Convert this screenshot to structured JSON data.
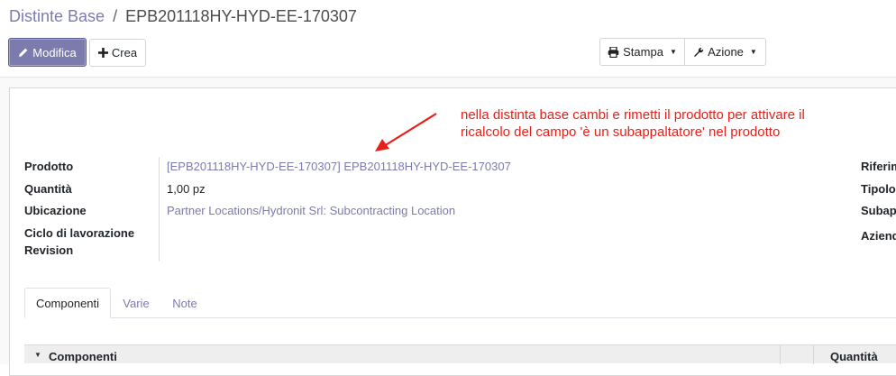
{
  "breadcrumb": {
    "parent": "Distinte Base",
    "separator": "/",
    "current": "EPB201118HY-HYD-EE-170307"
  },
  "toolbar": {
    "edit_label": "Modifica",
    "create_label": "Crea",
    "print_label": "Stampa",
    "action_label": "Azione"
  },
  "annotation": {
    "line1": "nella distinta base cambi e rimetti il prodotto per attivare il",
    "line2": "ricalcolo del campo 'è un subappaltatore' nel prodotto",
    "color": "#e8201a"
  },
  "fields": {
    "product_label": "Prodotto",
    "product_value": "[EPB201118HY-HYD-EE-170307] EPB201118HY-HYD-EE-170307",
    "quantity_label": "Quantità",
    "quantity_value": "1,00 pz",
    "location_label": "Ubicazione",
    "location_value": "Partner Locations/Hydronit Srl: Subcontracting Location",
    "routing_label": "Ciclo di lavorazione",
    "revision_label": "Revision"
  },
  "right_fields": {
    "reference_label": "Riferim",
    "type_label": "Tipolo",
    "subcontract_label": "Subap",
    "company_label": "Aziend"
  },
  "tabs": [
    {
      "label": "Componenti"
    },
    {
      "label": "Varie"
    },
    {
      "label": "Note"
    }
  ],
  "table": {
    "col_components": "Componenti",
    "col_quantity": "Quantità"
  },
  "colors": {
    "primary": "#7c7bad",
    "link": "#7c7bad"
  }
}
